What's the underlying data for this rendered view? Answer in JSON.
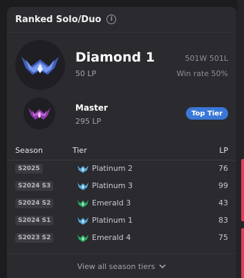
{
  "card": {
    "title": "Ranked Solo/Duo",
    "current": {
      "rank": "Diamond 1",
      "lp": "50 LP",
      "record": "501W 501L",
      "winrate": "Win rate 50%"
    },
    "peak": {
      "rank": "Master",
      "lp": "295 LP",
      "badge": "Top Tier"
    }
  },
  "table": {
    "headers": {
      "season": "Season",
      "tier": "Tier",
      "lp": "LP"
    },
    "rows": [
      {
        "season": "S2025",
        "tier": "Platinum 2",
        "lp": "76",
        "icon": "platinum-icon",
        "color": "#5aa9d8"
      },
      {
        "season": "S2024 S3",
        "tier": "Platinum 3",
        "lp": "99",
        "icon": "platinum-icon",
        "color": "#5aa9d8"
      },
      {
        "season": "S2024 S2",
        "tier": "Emerald 3",
        "lp": "43",
        "icon": "emerald-icon",
        "color": "#2fae66"
      },
      {
        "season": "S2024 S1",
        "tier": "Platinum 1",
        "lp": "83",
        "icon": "platinum-icon",
        "color": "#5aa9d8"
      },
      {
        "season": "S2023 S2",
        "tier": "Emerald 4",
        "lp": "75",
        "icon": "emerald-icon",
        "color": "#2fae66"
      }
    ]
  },
  "footer": {
    "label": "View all season tiers"
  },
  "colors": {
    "accent": "#3a78d8",
    "diamond": "#5b7fe0",
    "master": "#c05bd6"
  }
}
